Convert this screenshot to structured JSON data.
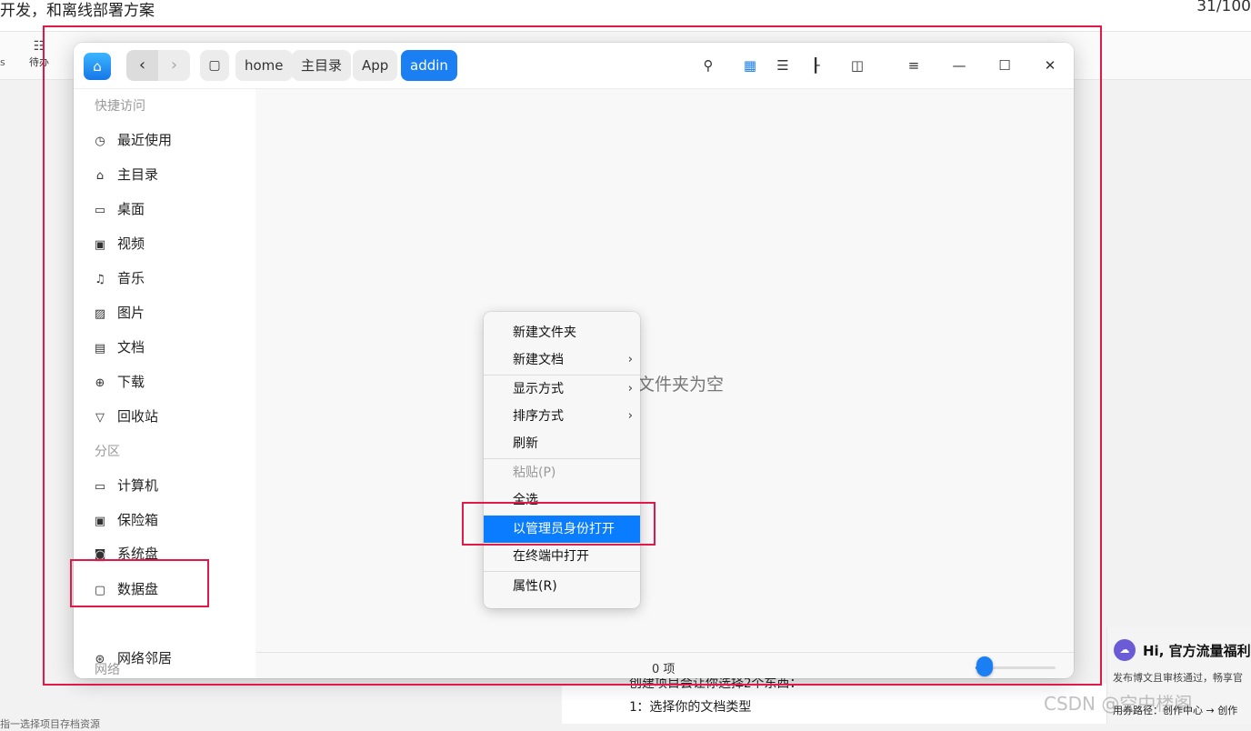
{
  "background": {
    "title_fragment": "开发，和离线部署方案",
    "char_count": "31/100",
    "toolbar_todo_label": "待办",
    "edge_label_left": "s",
    "doc_lines": [
      "创建项目会让你选择2个东西：",
      "1：选择你的文档类型"
    ],
    "right_panel": {
      "avatar_glyph": "☁",
      "title": "Hi, 官方流量福利",
      "desc": "发布博文且审核通过，畅享官",
      "path": "用券路径：创作中心 → 创作"
    },
    "watermark": "CSDN @空中楼阁",
    "bottom_left_fragment": "指一选择项目存档资源"
  },
  "file_manager": {
    "breadcrumbs": [
      "home",
      "主目录",
      "App",
      "addin"
    ],
    "active_crumb": "addin",
    "sidebar": {
      "groups": {
        "quick": "快捷访问",
        "partitions": "分区",
        "network": "网络"
      },
      "items": [
        {
          "label": "最近使用",
          "icon": "clock-icon"
        },
        {
          "label": "主目录",
          "icon": "home-icon"
        },
        {
          "label": "桌面",
          "icon": "desktop-icon"
        },
        {
          "label": "视频",
          "icon": "video-icon"
        },
        {
          "label": "音乐",
          "icon": "music-icon"
        },
        {
          "label": "图片",
          "icon": "picture-icon"
        },
        {
          "label": "文档",
          "icon": "document-icon"
        },
        {
          "label": "下载",
          "icon": "download-icon"
        },
        {
          "label": "回收站",
          "icon": "trash-icon"
        },
        {
          "label": "计算机",
          "icon": "computer-icon"
        },
        {
          "label": "保险箱",
          "icon": "safe-icon"
        },
        {
          "label": "系统盘",
          "icon": "system-disk-icon"
        },
        {
          "label": "数据盘",
          "icon": "data-disk-icon"
        },
        {
          "label": "网络邻居",
          "icon": "network-icon"
        }
      ]
    },
    "empty_message": "文件夹为空",
    "status": {
      "item_count": "0 项",
      "zoom_level": 0.05
    }
  },
  "context_menu": {
    "items": [
      {
        "label": "新建文件夹",
        "submenu": false
      },
      {
        "label": "新建文档",
        "submenu": true
      },
      {
        "label": "显示方式",
        "submenu": true
      },
      {
        "label": "排序方式",
        "submenu": true
      },
      {
        "label": "刷新",
        "submenu": false
      },
      {
        "label": "粘贴(P)",
        "submenu": false,
        "disabled": true
      },
      {
        "label": "全选",
        "submenu": false
      },
      {
        "label": "以管理员身份打开",
        "submenu": false,
        "selected": true
      },
      {
        "label": "在终端中打开",
        "submenu": false
      },
      {
        "label": "属性(R)",
        "submenu": false
      }
    ]
  },
  "colors": {
    "accent": "#1a7ff2",
    "annotation_red": "#e0194a",
    "menu_highlight": "#0a7cff"
  }
}
